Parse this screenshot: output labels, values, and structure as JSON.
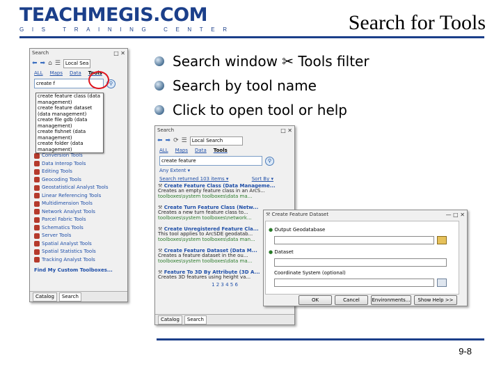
{
  "logo": {
    "main": "TEACHMEGIS.COM",
    "sub": "GIS TRAINING CENTER"
  },
  "slide_title": "Search for Tools",
  "bullets": [
    "Search window ✂ Tools filter",
    "Search by tool name",
    "Click to open tool or help"
  ],
  "colors": {
    "brand": "#1b3f8a",
    "link": "#1f4fa8",
    "path": "#2a7a2a",
    "highlight_circle": "#e0141e"
  },
  "left_window": {
    "title": "Search",
    "scope": "Local Sea",
    "tabs": [
      "ALL",
      "Maps",
      "Data",
      "Tools"
    ],
    "query": "create f",
    "suggestions": [
      "create feature class (data management)",
      "create feature dataset (data management)",
      "create file gdb (data management)",
      "create fishnet (data management)",
      "create folder (data management)"
    ],
    "toolbox_items": [
      "Conversion Tools",
      "Data Interop Tools",
      "Editing Tools",
      "Geocoding Tools",
      "Geostatistical Analyst Tools",
      "Linear Referencing Tools",
      "Multidimension Tools",
      "Network Analyst Tools",
      "Parcel Fabric Tools",
      "Schematics Tools",
      "Server Tools",
      "Spatial Analyst Tools",
      "Spatial Statistics Tools",
      "Tracking Analyst Tools"
    ],
    "find_link": "Find My Custom Toolboxes...",
    "status_tabs": [
      "Catalog",
      "Search"
    ]
  },
  "mid_window": {
    "title": "Search",
    "scope": "Local Search",
    "tabs": [
      "ALL",
      "Maps",
      "Data",
      "Tools"
    ],
    "query": "create feature",
    "any_extent": "Any Extent ▾",
    "results_summary": "Search returned 103 items ▾",
    "sort_by": "Sort By ▾",
    "results": [
      {
        "title": "Create Feature Class (Data Manageme...",
        "desc": "Creates an empty feature class in an ArcS...",
        "path": "toolboxes\\system toolboxes\\data ma..."
      },
      {
        "title": "Create Turn Feature Class (Netw...",
        "desc": "Creates a new turn feature class to...",
        "path": "toolboxes\\system toolboxes\\network..."
      },
      {
        "title": "Create Unregistered Feature Cla...",
        "desc": "This tool applies to ArcSDE geodatab...",
        "path": "toolboxes\\system toolboxes\\data man..."
      },
      {
        "title": "Create Feature Dataset (Data M...",
        "desc": "Creates a feature dataset in the ou...",
        "path": "toolboxes\\system toolboxes\\data ma..."
      },
      {
        "title": "Feature To 3D By Attribute (3D A...",
        "desc": "Creates 3D features using height va...",
        "path": "toolboxes\\system toolboxes\\3d ana..."
      }
    ],
    "pages": "1 2 3 4 5 6",
    "status_tabs": [
      "Catalog",
      "Search"
    ]
  },
  "dialog": {
    "title": "Create Feature Dataset",
    "fields": [
      "Output Geodatabase",
      "Dataset",
      "Coordinate System (optional)"
    ],
    "buttons": [
      "OK",
      "Cancel",
      "Environments...",
      "Show Help >>"
    ]
  },
  "page_number": "9-8"
}
